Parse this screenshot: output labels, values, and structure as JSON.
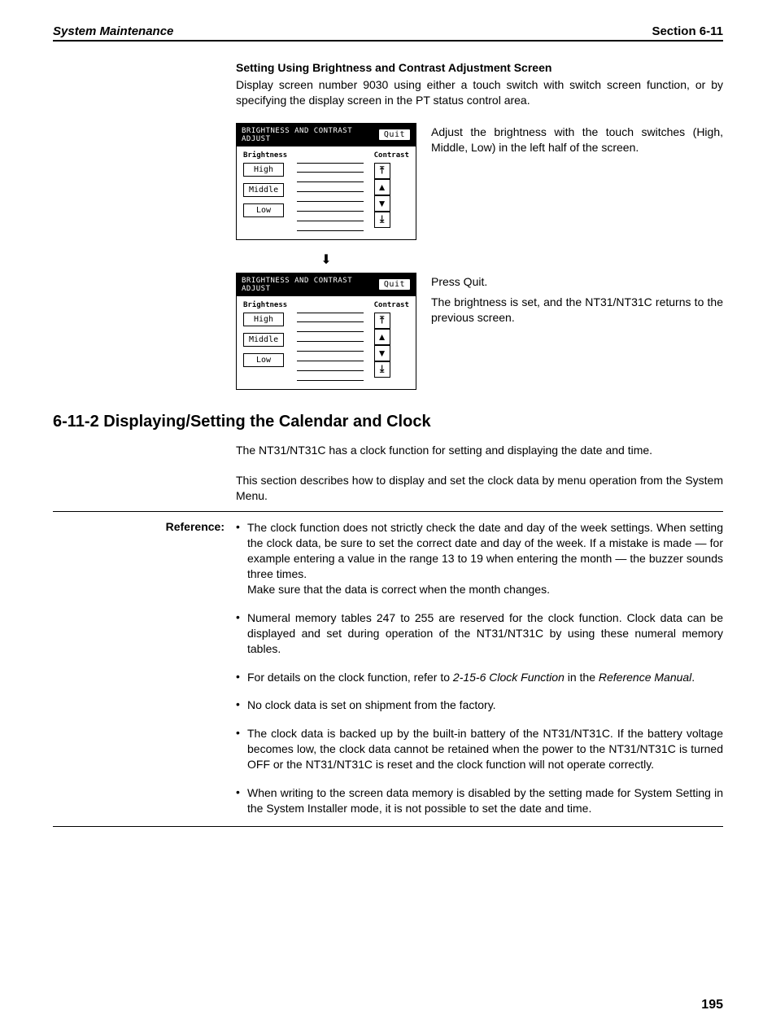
{
  "header": {
    "left": "System Maintenance",
    "right": "Section  6-11"
  },
  "heading1": "Setting Using Brightness and Contrast Adjustment Screen",
  "para1": "Display screen number 9030 using either a touch switch with switch screen function, or by specifying the display screen in the PT status control area.",
  "screenshot": {
    "title": "BRIGHTNESS AND CONTRAST ADJUST",
    "quit": "Quit",
    "brightness_label": "Brightness",
    "contrast_label": "Contrast",
    "high": "High",
    "middle": "Middle",
    "low": "Low"
  },
  "caption1": "Adjust the brightness with the touch switches (High, Middle, Low) in the left half of the screen.",
  "caption2a": "Press Quit.",
  "caption2b": "The brightness is set, and the NT31/NT31C returns to the previous screen.",
  "section_heading": "6-11-2 Displaying/Setting the Calendar and Clock",
  "para2": "The NT31/NT31C has a clock function for setting and displaying the date and time.",
  "para3": "This section describes how to display and set the clock data by menu operation from the System Menu.",
  "reference_label": "Reference:",
  "bullets": [
    {
      "text": "The clock function does not strictly check the date and day of the week settings. When setting the clock data, be sure to set the correct date and day of the week. If a mistake is made — for example entering a value in the range 13 to 19 when entering the month — the buzzer sounds three times.",
      "extra": "Make sure that the data is correct when the month changes."
    },
    {
      "text": "Numeral memory tables 247 to 255 are reserved for the clock function. Clock data can be displayed and set during operation of the NT31/NT31C by using these numeral memory tables."
    },
    {
      "prefix": "For details on the clock function, refer to ",
      "italic1": "2-15-6 Clock Function",
      "mid": " in the ",
      "italic2": "Reference Manual",
      "suffix": "."
    },
    {
      "text": "No clock data is set on shipment from the factory."
    },
    {
      "text": "The clock data is backed up by the built-in battery of the NT31/NT31C. If the battery voltage becomes low, the clock data cannot be retained when the power to the NT31/NT31C is turned OFF or the NT31/NT31C is reset and the clock function will not operate correctly."
    },
    {
      "text": "When writing to the screen data memory is disabled by the setting made for System Setting in the System Installer mode, it is not possible to set the date and time."
    }
  ],
  "page_number": "195"
}
